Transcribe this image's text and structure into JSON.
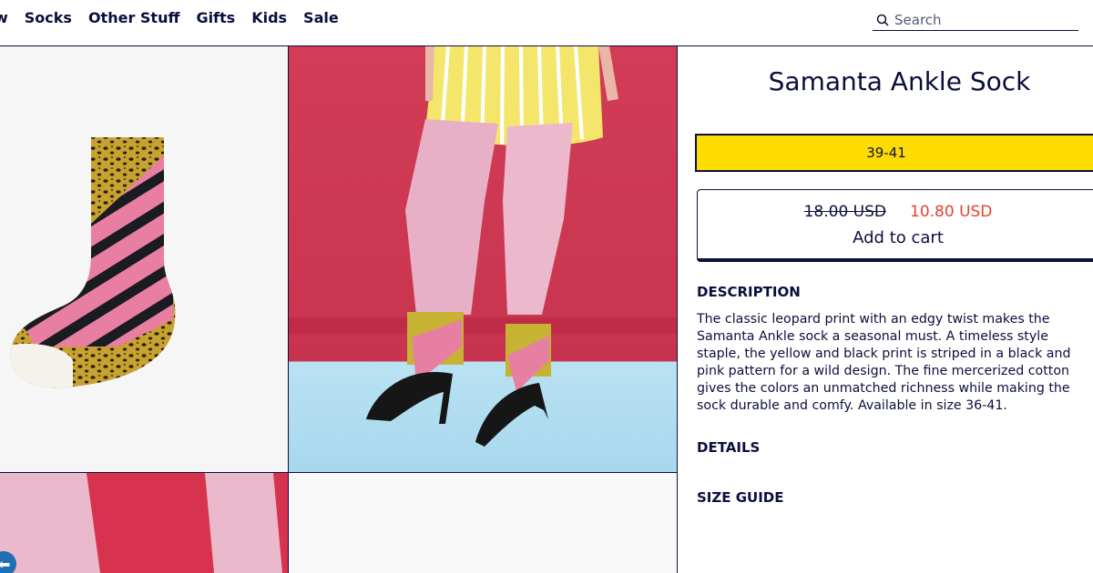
{
  "nav": {
    "items": [
      "w",
      "Socks",
      "Other Stuff",
      "Gifts",
      "Kids",
      "Sale"
    ],
    "search_placeholder": "Search"
  },
  "product": {
    "title": "Samanta Ankle Sock",
    "size": "39-41",
    "old_price": "18.00 USD",
    "new_price": "10.80 USD",
    "add_to_cart": "Add to cart"
  },
  "sections": {
    "description_heading": "DESCRIPTION",
    "description_text": "The classic leopard print with an edgy twist makes the Samanta Ankle sock a seasonal must. A timeless style staple, the yellow and black print is striped in a black and pink pattern for a wild design. The fine mercerized cotton gives the colors an unmatched richness while making the sock durable and comfy. Available in size 36-41.",
    "details_heading": "DETAILS",
    "size_guide_heading": "SIZE GUIDE"
  },
  "colors": {
    "navy": "#0b0f3c",
    "size_yellow": "#ffdc00",
    "sale_red": "#e8412c",
    "backdrop_red": "#d23c56"
  }
}
